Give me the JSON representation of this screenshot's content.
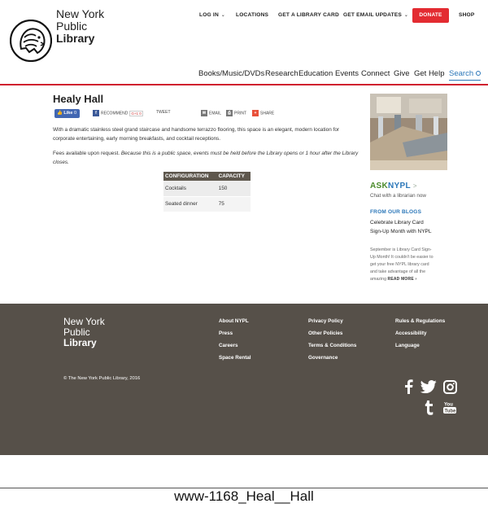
{
  "brand": {
    "line1": "New York",
    "line2": "Public",
    "line3": "Library"
  },
  "utility_nav": [
    {
      "label": "LOG IN",
      "caret": true
    },
    {
      "label": "LOCATIONS",
      "caret": false
    },
    {
      "label": "GET A LIBRARY CARD",
      "caret": false
    },
    {
      "label": "GET EMAIL UPDATES",
      "caret": true
    },
    {
      "label": "DONATE",
      "caret": false
    },
    {
      "label": "SHOP",
      "caret": false
    }
  ],
  "main_nav": [
    "Books/Music/DVDs",
    "Research",
    "Education",
    "Events",
    "Connect",
    "Give",
    "Get Help",
    "Search"
  ],
  "accent": "#d0202e",
  "page": {
    "title": "Healy Hall",
    "share": {
      "like": "Like",
      "like_count": "0",
      "recommend": "RECOMMEND",
      "gplus": "G+1",
      "gplus_count": "0",
      "tweet": "TWEET",
      "email": "EMAIL",
      "print": "PRINT",
      "share": "SHARE"
    },
    "para1": "With a dramatic stainless steel grand staircase and handsome terrazzo flooring, this space is an elegant, modern location for corporate entertaining, early morning breakfasts, and cocktail receptions.",
    "para2_plain": "Fees available upon request. ",
    "para2_italic": "Because this is a public space, events must be held before the Library opens or 1 hour after the Library closes.",
    "table": {
      "headers": [
        "CONFIGURATION",
        "CAPACITY"
      ],
      "rows": [
        [
          "Cocktails",
          "150"
        ],
        [
          "Seated dinner",
          "75"
        ]
      ]
    }
  },
  "sidebar": {
    "ask_a": "ASK",
    "ask_b": "NYPL",
    "ask_arrow": ">",
    "ask_sub": "Chat with a librarian now",
    "blogs_heading": "FROM OUR BLOGS",
    "blog_title": "Celebrate Library Card Sign-Up Month with NYPL",
    "blog_excerpt": "September is Library Card Sign-Up Month! It couldn't be easier to get your free NYPL library card and take advantage of all the amazing",
    "read_more": "READ MORE ›"
  },
  "footer": {
    "col1": [
      "About NYPL",
      "Press",
      "Careers",
      "Space Rental"
    ],
    "col2": [
      "Privacy Policy",
      "Other Policies",
      "Terms & Conditions",
      "Governance"
    ],
    "col3": [
      "Rules & Regulations",
      "Accessibility",
      "Language"
    ],
    "copyright": "© The New York Public Library, 2016",
    "social_icons": [
      "facebook-icon",
      "twitter-icon",
      "instagram-icon",
      "tumblr-icon",
      "youtube-icon"
    ]
  },
  "caption": "www-1168_Heal__Hall"
}
